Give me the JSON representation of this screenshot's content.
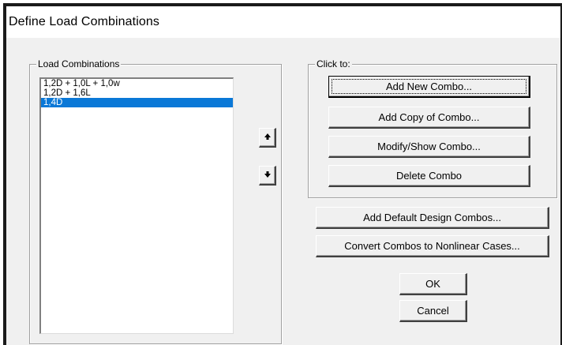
{
  "window": {
    "title": "Define Load Combinations"
  },
  "load_combinations": {
    "group_label": "Load Combinations",
    "items": [
      {
        "label": "1,2D + 1,0L + 1,0w",
        "selected": false
      },
      {
        "label": "1,2D + 1,6L",
        "selected": false
      },
      {
        "label": "1,4D",
        "selected": true
      }
    ],
    "move_up_icon": "arrow-up-icon",
    "move_down_icon": "arrow-down-icon"
  },
  "click_to": {
    "group_label": "Click to:",
    "add_new": "Add New Combo...",
    "add_copy": "Add Copy of Combo...",
    "modify_show": "Modify/Show Combo...",
    "delete": "Delete Combo"
  },
  "buttons": {
    "add_default": "Add Default Design Combos...",
    "convert": "Convert Combos to Nonlinear Cases...",
    "ok": "OK",
    "cancel": "Cancel"
  },
  "colors": {
    "selection": "#0a78d7",
    "dialog_bg": "#f0f0f0"
  }
}
